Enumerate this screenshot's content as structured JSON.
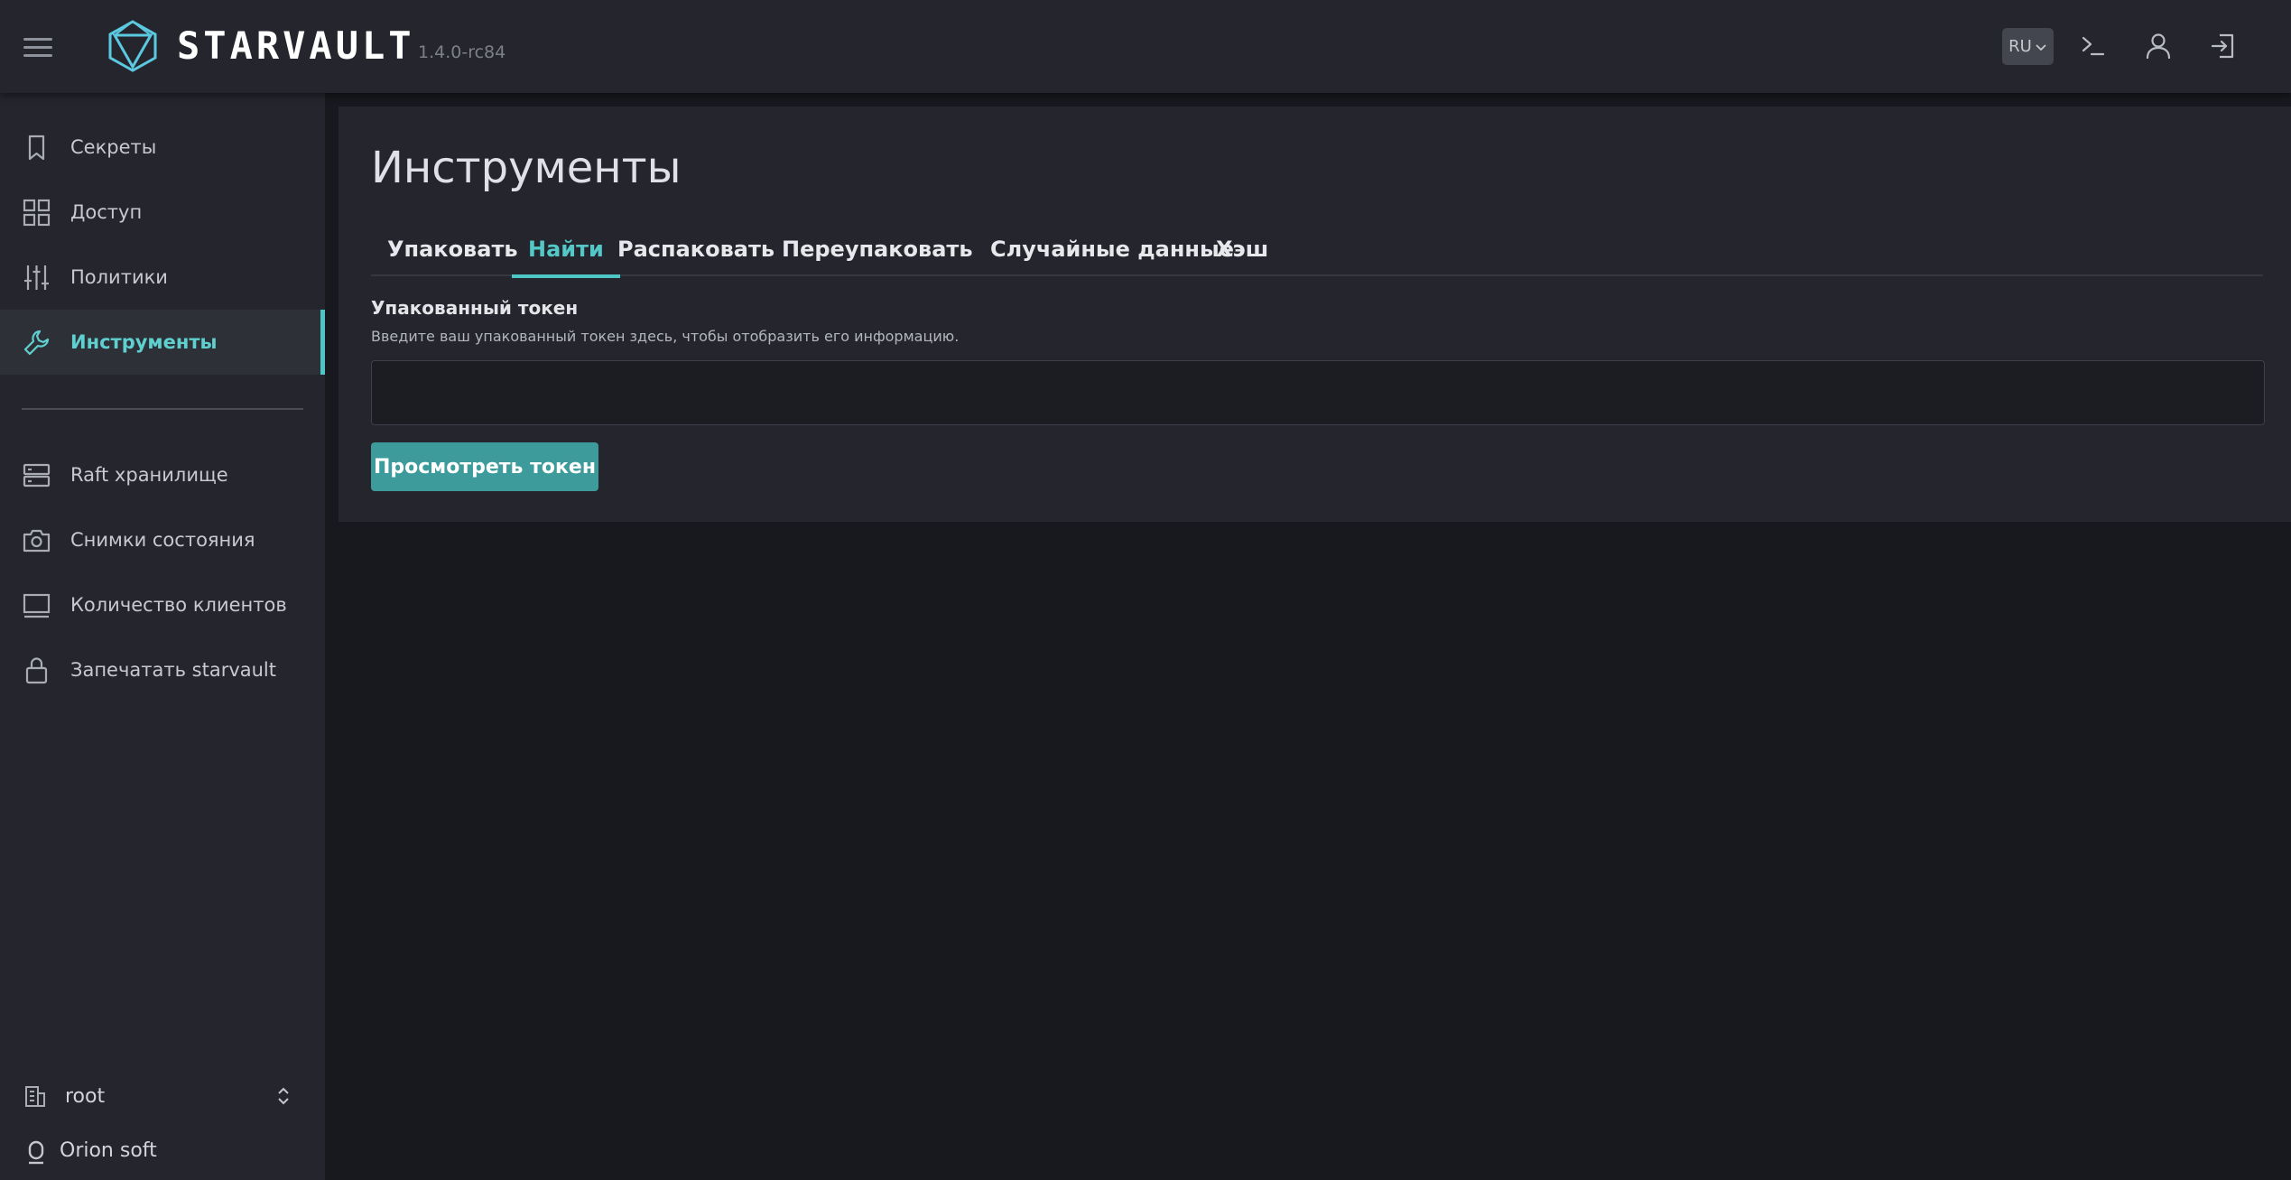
{
  "header": {
    "brand": "STARVAULT",
    "version": "1.4.0-rc84",
    "language": "RU",
    "icons": [
      "menu-icon",
      "logo-icon",
      "chevron-down-icon",
      "terminal-icon",
      "user-icon",
      "logout-icon"
    ]
  },
  "sidebar": {
    "items": [
      {
        "label": "Секреты",
        "icon": "bookmark-icon"
      },
      {
        "label": "Доступ",
        "icon": "grid-icon"
      },
      {
        "label": "Политики",
        "icon": "sliders-icon"
      },
      {
        "label": "Инструменты",
        "icon": "wrench-icon",
        "active": true
      },
      {
        "label": "Raft хранилище",
        "icon": "server-icon"
      },
      {
        "label": "Снимки состояния",
        "icon": "camera-icon"
      },
      {
        "label": "Количество клиентов",
        "icon": "monitor-icon"
      },
      {
        "label": "Запечатать starvault",
        "icon": "lock-icon"
      }
    ],
    "namespace": "root",
    "organization": "Orion soft"
  },
  "main": {
    "title": "Инструменты",
    "tabs": [
      {
        "label": "Упаковать"
      },
      {
        "label": "Найти",
        "active": true
      },
      {
        "label": "Распаковать"
      },
      {
        "label": "Переупаковать"
      },
      {
        "label": "Случайные данные"
      },
      {
        "label": "Хэш"
      }
    ],
    "form": {
      "label": "Упакованный токен",
      "help": "Введите ваш упакованный токен здесь, чтобы отобразить его информацию.",
      "value": "",
      "placeholder": "",
      "submit": "Просмотреть токен"
    }
  },
  "colors": {
    "accent": "#4dc7c6",
    "button": "#3d9c9b",
    "header_bg": "#25262d",
    "page_bg": "#18191e"
  }
}
